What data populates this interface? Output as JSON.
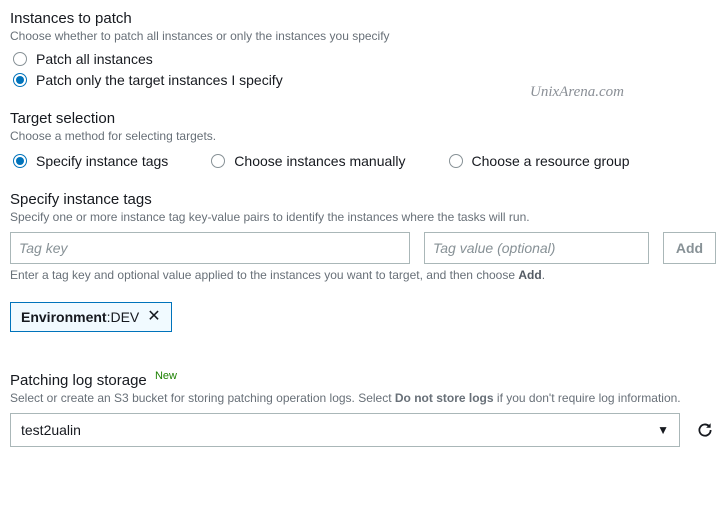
{
  "watermark": "UnixArena.com",
  "instances_to_patch": {
    "title": "Instances to patch",
    "desc": "Choose whether to patch all instances or only the instances you specify",
    "options": {
      "all": "Patch all instances",
      "target": "Patch only the target instances I specify"
    },
    "selected": "target"
  },
  "target_selection": {
    "title": "Target selection",
    "desc": "Choose a method for selecting targets.",
    "options": {
      "tags": "Specify instance tags",
      "manual": "Choose instances manually",
      "group": "Choose a resource group"
    },
    "selected": "tags"
  },
  "specify_tags": {
    "title": "Specify instance tags",
    "desc": "Specify one or more instance tag key-value pairs to identify the instances where the tasks will run.",
    "key_placeholder": "Tag key",
    "value_placeholder": "Tag value (optional)",
    "add_label": "Add",
    "helper_pre": "Enter a tag key and optional value applied to the instances you want to target, and then choose ",
    "helper_bold": "Add",
    "helper_post": "."
  },
  "existing_tag": {
    "key": "Environment",
    "sep": " : ",
    "value": "DEV"
  },
  "log_storage": {
    "title": "Patching log storage",
    "new_label": "New",
    "desc_pre": "Select or create an S3 bucket for storing patching operation logs. Select ",
    "desc_bold": "Do not store logs",
    "desc_post": " if you don't require log information.",
    "selected_bucket": "test2ualin"
  }
}
